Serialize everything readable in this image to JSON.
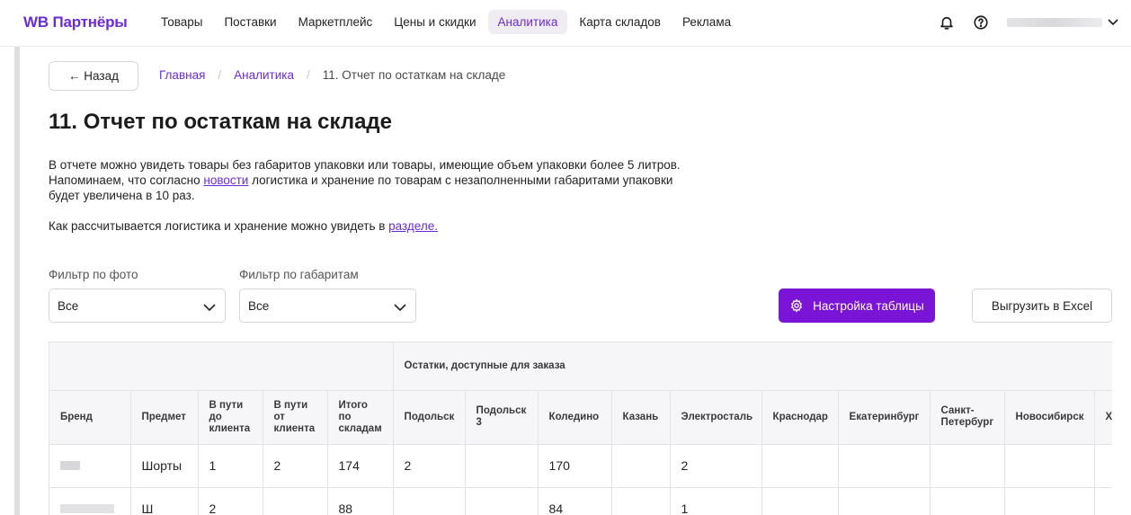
{
  "header": {
    "logo": "WB Партнёры",
    "nav": [
      "Товары",
      "Поставки",
      "Маркетплейс",
      "Цены и скидки",
      "Аналитика",
      "Карта складов",
      "Реклама"
    ],
    "active_nav": "Аналитика"
  },
  "back_label": "← Назад",
  "breadcrumb": {
    "home": "Главная",
    "section": "Аналитика",
    "current": "11. Отчет по остаткам на складе"
  },
  "title": "11. Отчет по остаткам на складе",
  "description": {
    "line1": "В отчете можно увидеть товары без габаритов упаковки или товары, имеющие объем упаковки более 5 литров.",
    "line2_before": "Напоминаем, что согласно ",
    "line2_link": "новости",
    "line2_after": " логистика и хранение по товарам с незаполненными габаритами упаковки",
    "line3": "будет увеличена в 10 раз.",
    "line4_before": "Как рассчитывается логистика и хранение можно увидеть в ",
    "line4_link": "разделе."
  },
  "filters": {
    "photo_label": "Фильтр по фото",
    "photo_value": "Все",
    "dims_label": "Фильтр по габаритам",
    "dims_value": "Все"
  },
  "buttons": {
    "settings": "Настройка таблицы",
    "export": "Выгрузить в Excel"
  },
  "table": {
    "group_header": "Остатки, доступные для заказа",
    "columns": [
      "Бренд",
      "Предмет",
      "В пути\nдо\nклиента",
      "В пути\nот\nклиента",
      "Итого\nпо\nскладам",
      "Подольск",
      "Подольск\n3",
      "Коледино",
      "Казань",
      "Электросталь",
      "Краснодар",
      "Екатеринбург",
      "Санкт-\nПетербург",
      "Новосибирск",
      "Х"
    ],
    "rows": [
      [
        "",
        "Шорты",
        "1",
        "2",
        "174",
        "2",
        "",
        "170",
        "",
        "2",
        "",
        "",
        "",
        "",
        ""
      ],
      [
        "",
        "Ш",
        "2",
        "",
        "88",
        "",
        "",
        "84",
        "",
        "1",
        "",
        "",
        "",
        "",
        ""
      ]
    ]
  },
  "colors": {
    "accent": "#6c2bd9",
    "primary_button": "#7a14d6",
    "nav_active_bg": "#efedf3"
  },
  "icons": [
    "bell-icon",
    "help-icon",
    "chevron-down-icon",
    "gear-icon"
  ]
}
